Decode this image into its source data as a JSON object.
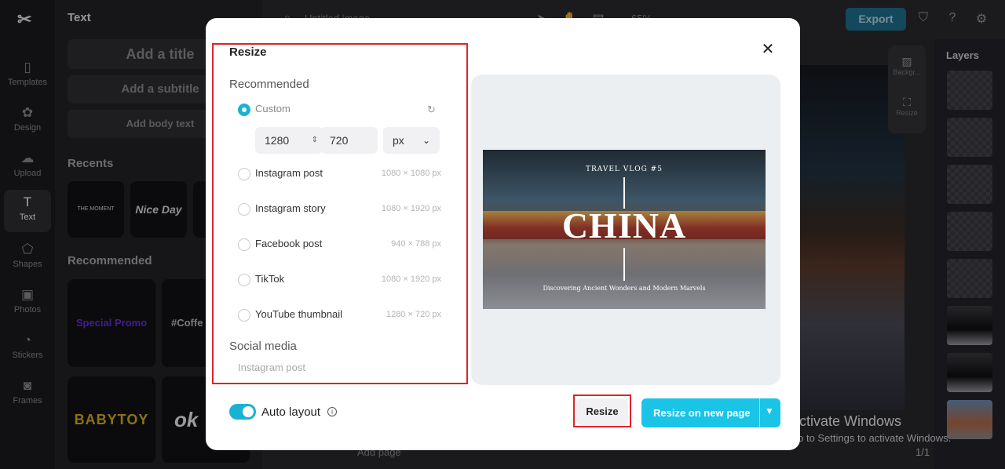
{
  "rail": {
    "items": [
      {
        "label": "Templates",
        "icon": "templates-icon"
      },
      {
        "label": "Design",
        "icon": "design-icon"
      },
      {
        "label": "Upload",
        "icon": "upload-icon"
      },
      {
        "label": "Text",
        "icon": "text-icon"
      },
      {
        "label": "Shapes",
        "icon": "shapes-icon"
      },
      {
        "label": "Photos",
        "icon": "photos-icon"
      },
      {
        "label": "Stickers",
        "icon": "stickers-icon"
      },
      {
        "label": "Frames",
        "icon": "frames-icon"
      }
    ]
  },
  "panel": {
    "title": "Text",
    "add_title": "Add a title",
    "add_subtitle": "Add a subtitle",
    "add_body": "Add body text",
    "recents": "Recents",
    "recommended": "Recommended",
    "recent_tiles": [
      "THE MOMENT",
      "Nice Day"
    ],
    "rec_tiles": [
      "Special Promo",
      "#Coffe",
      "BABYTOY",
      "ok"
    ]
  },
  "topbar": {
    "doc_title": "Untitled image",
    "zoom": "65%",
    "export_label": "Export"
  },
  "side_tools": {
    "background": "Backgr...",
    "resize": "Resize"
  },
  "layers": {
    "title": "Layers"
  },
  "bottom": {
    "add_page": "Add page",
    "page_count": "1/1"
  },
  "watermark": {
    "title": "Activate Windows",
    "subtitle": "Go to Settings to activate Windows."
  },
  "modal": {
    "title": "Resize",
    "recommended": "Recommended",
    "custom_label": "Custom",
    "width": "1280",
    "height": "720",
    "unit": "px",
    "options": [
      {
        "label": "Instagram post",
        "size": "1080 × 1080 px"
      },
      {
        "label": "Instagram story",
        "size": "1080 × 1920 px"
      },
      {
        "label": "Facebook post",
        "size": "940 × 788 px"
      },
      {
        "label": "TikTok",
        "size": "1080 × 1920 px"
      },
      {
        "label": "YouTube thumbnail",
        "size": "1280 × 720 px"
      }
    ],
    "social_media": "Social media",
    "social_first": "Instagram post",
    "preview": {
      "kicker": "TRAVEL VLOG #5",
      "headline": "CHINA",
      "caption": "Discovering Ancient Wonders and Modern Marvels"
    },
    "auto_layout": "Auto layout",
    "resize_label": "Resize",
    "resize_new_label": "Resize on new page",
    "accent": "#19b2d4",
    "highlight": "#e0222a"
  }
}
